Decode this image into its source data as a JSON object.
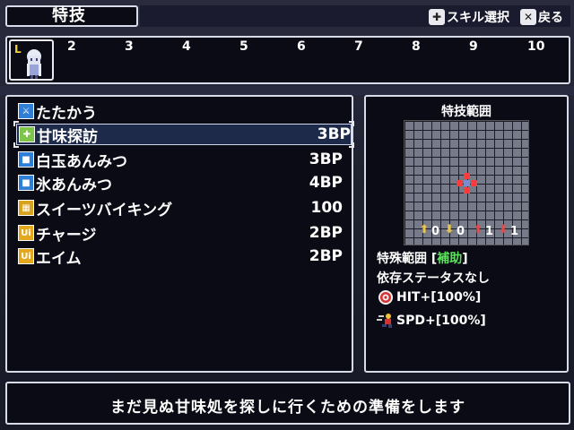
{
  "header": {
    "title": "特技",
    "skill_select_label": "スキル選択",
    "back_label": "戻る",
    "skill_select_key_icon": "dpad-icon",
    "back_key_icon": "x-button-icon"
  },
  "turn_bar": {
    "first_slot_label": "L",
    "numbers": [
      "2",
      "3",
      "4",
      "5",
      "6",
      "7",
      "8",
      "9",
      "10"
    ]
  },
  "skills": [
    {
      "icon": "sword-icon",
      "name": "たたかう",
      "cost": ""
    },
    {
      "icon": "heal-plus-icon",
      "name": "甘味探訪",
      "cost": "3BP",
      "selected": true
    },
    {
      "icon": "blue-square-icon",
      "name": "白玉あんみつ",
      "cost": "3BP"
    },
    {
      "icon": "blue-square-icon",
      "name": "氷あんみつ",
      "cost": "4BP"
    },
    {
      "icon": "gold-grid-icon",
      "name": "スイーツバイキング",
      "cost": "100"
    },
    {
      "icon": "up-buff-icon",
      "name": "チャージ",
      "cost": "2BP"
    },
    {
      "icon": "up-buff-icon",
      "name": "エイム",
      "cost": "2BP"
    }
  ],
  "range": {
    "title": "特技範囲",
    "elevations": [
      "0",
      "0",
      "1",
      "1"
    ],
    "special_range_label": "特殊範囲 [",
    "special_range_value": "補助",
    "special_range_close": "]",
    "dependent_status": "依存ステータスなし",
    "buffs": [
      {
        "icon": "target-icon",
        "text": "HIT+[100%]"
      },
      {
        "icon": "speed-runner-icon",
        "text": "SPD+[100%]"
      }
    ]
  },
  "description": "まだ見ぬ甘味処を探しに行くための準備をします",
  "colors": {
    "panel_border": "#d8dbe8",
    "panel_bg": "#0a0b14",
    "highlight_green": "#5be25b",
    "range_red": "#ff3b3b",
    "selection_bg": "#1d2a4a"
  }
}
